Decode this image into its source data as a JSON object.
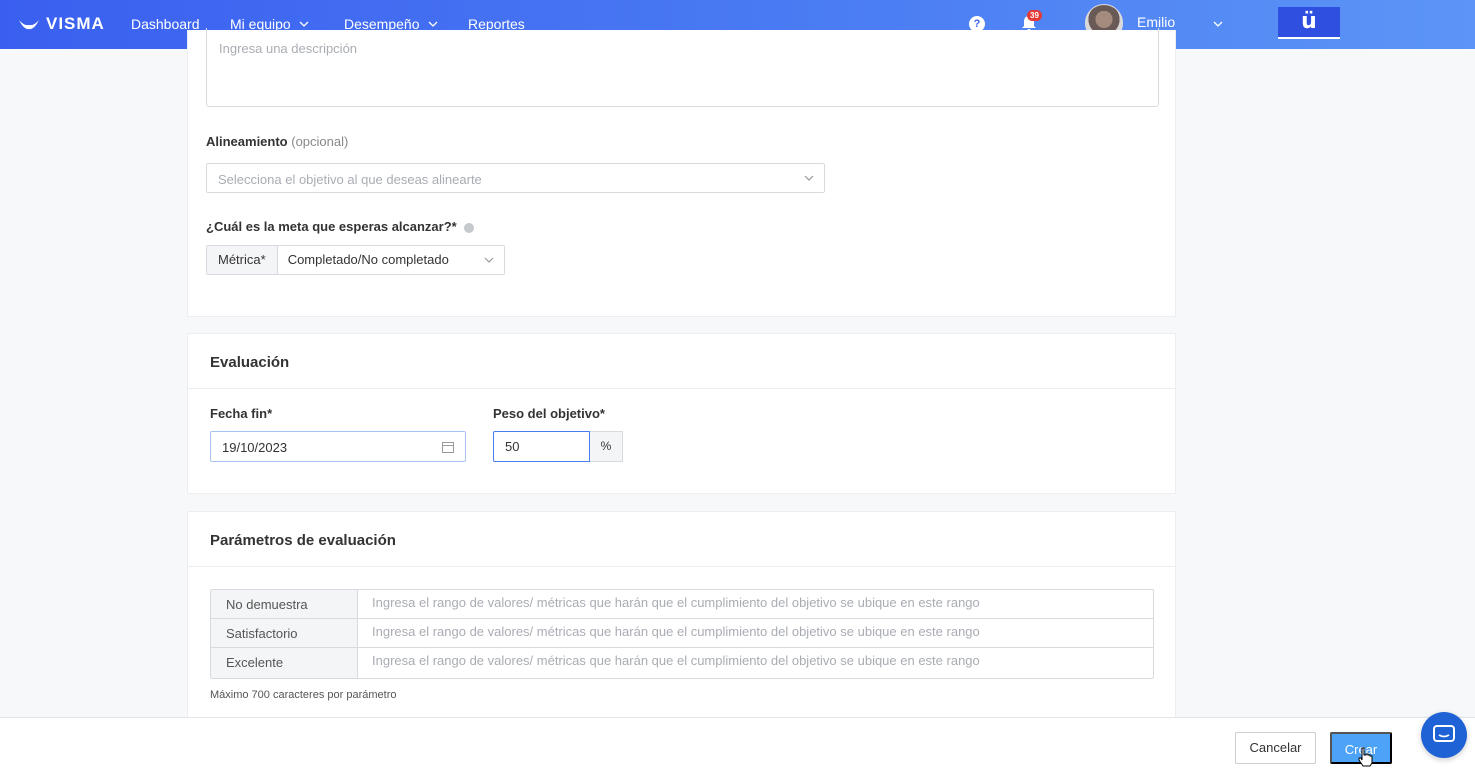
{
  "nav": {
    "brand": "VISMA",
    "items": [
      {
        "label": "Dashboard",
        "has_dropdown": false
      },
      {
        "label": "Mi equipo",
        "has_dropdown": true
      },
      {
        "label": "Desempeño",
        "has_dropdown": true
      },
      {
        "label": "Reportes",
        "has_dropdown": false
      }
    ],
    "help_icon": "question-circle-icon",
    "notifications_count": "39",
    "user_name": "Emilio",
    "app_switch_label": "ü"
  },
  "form": {
    "description_placeholder": "Ingresa una descripción",
    "alignment": {
      "label": "Alineamiento",
      "optional": "(opcional)",
      "placeholder": "Selecciona el objetivo al que deseas alinearte"
    },
    "goal": {
      "label": "¿Cuál es la meta que esperas alcanzar?*",
      "metric_label": "Métrica*",
      "metric_value": "Completado/No completado"
    }
  },
  "evaluation": {
    "title": "Evaluación",
    "end_date_label": "Fecha fin*",
    "end_date_value": "19/10/2023",
    "weight_label": "Peso del objetivo*",
    "weight_value": "50",
    "weight_unit": "%"
  },
  "parameters": {
    "title": "Parámetros de evaluación",
    "rows": [
      {
        "name": "No demuestra",
        "placeholder": "Ingresa el rango de valores/ métricas que harán que el cumplimiento del objetivo se ubique en este rango"
      },
      {
        "name": "Satisfactorio",
        "placeholder": "Ingresa el rango de valores/ métricas que harán que el cumplimiento del objetivo se ubique en este rango"
      },
      {
        "name": "Excelente",
        "placeholder": "Ingresa el rango de valores/ métricas que harán que el cumplimiento del objetivo se ubique en este rango"
      }
    ],
    "note": "Máximo 700 caracteres por parámetro"
  },
  "footer": {
    "cancel_label": "Cancelar",
    "create_label": "Crear"
  },
  "colors": {
    "nav_gradient_start": "#3a5ff0",
    "nav_gradient_end": "#5c95f6",
    "primary_button": "#4da3f8",
    "chat_bubble": "#1f62d6"
  }
}
